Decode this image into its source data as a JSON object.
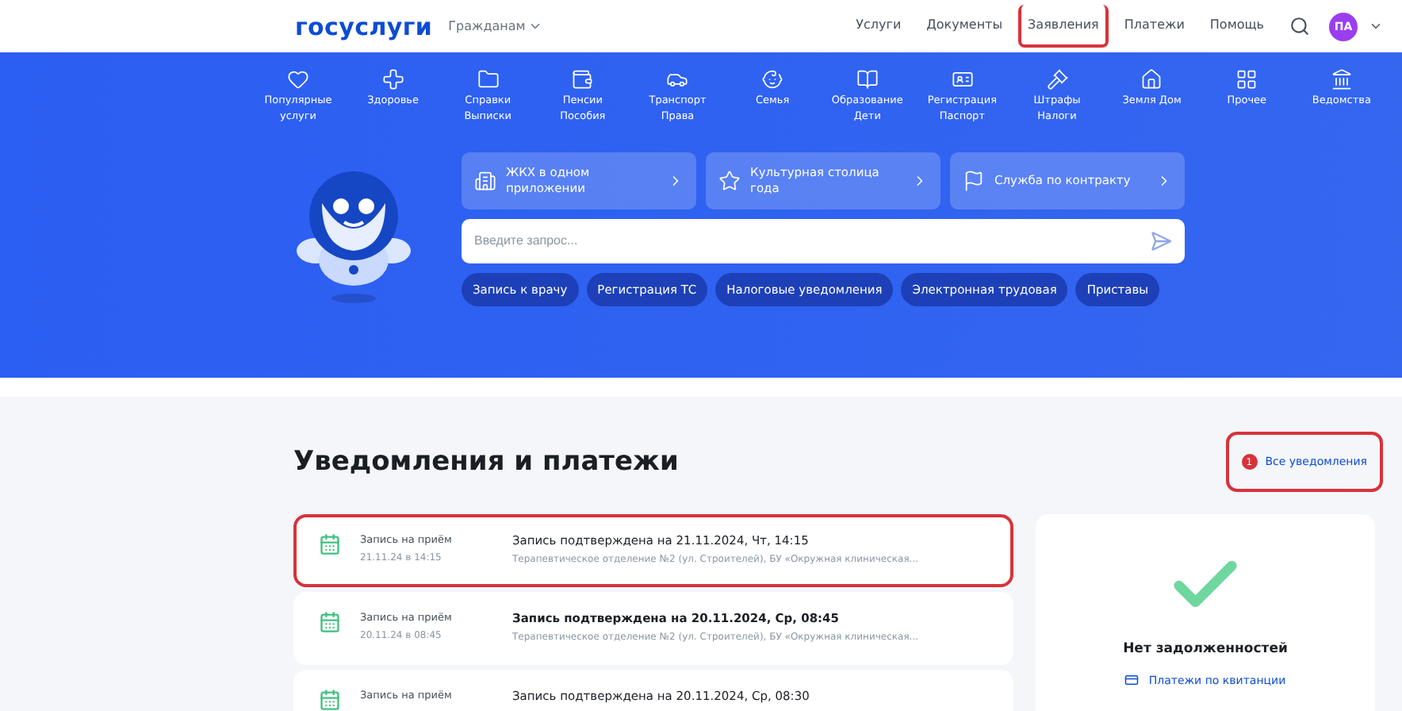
{
  "header": {
    "logo": "госуслуги",
    "audience": "Гражданам",
    "nav": [
      {
        "label": "Услуги",
        "highlighted": false
      },
      {
        "label": "Документы",
        "highlighted": false
      },
      {
        "label": "Заявления",
        "highlighted": true
      },
      {
        "label": "Платежи",
        "highlighted": false
      },
      {
        "label": "Помощь",
        "highlighted": false
      }
    ],
    "avatar": "ПА"
  },
  "categories": [
    {
      "lines": [
        "Популярные",
        "услуги"
      ]
    },
    {
      "lines": [
        "Здоровье"
      ]
    },
    {
      "lines": [
        "Справки",
        "Выписки"
      ]
    },
    {
      "lines": [
        "Пенсии",
        "Пособия"
      ]
    },
    {
      "lines": [
        "Транспорт",
        "Права"
      ]
    },
    {
      "lines": [
        "Семья"
      ]
    },
    {
      "lines": [
        "Образование",
        "Дети"
      ]
    },
    {
      "lines": [
        "Регистрация",
        "Паспорт"
      ]
    },
    {
      "lines": [
        "Штрафы",
        "Налоги"
      ]
    },
    {
      "lines": [
        "Земля Дом"
      ]
    },
    {
      "lines": [
        "Прочее"
      ]
    },
    {
      "lines": [
        "Ведомства"
      ]
    }
  ],
  "quick_links": [
    {
      "label": "ЖКХ в одном приложении"
    },
    {
      "label": "Культурная столица года"
    },
    {
      "label": "Служба по контракту"
    }
  ],
  "search": {
    "placeholder": "Введите запрос..."
  },
  "chips": [
    "Запись к врачу",
    "Регистрация ТС",
    "Налоговые уведомления",
    "Электронная трудовая",
    "Приставы"
  ],
  "notifications": {
    "title": "Уведомления и платежи",
    "all_link": {
      "label": "Все уведомления",
      "badge": "1",
      "highlighted": true
    },
    "items": [
      {
        "type": "Запись на приём",
        "date": "21.11.24 в 14:15",
        "title": "Запись подтверждена на 21.11.2024, Чт, 14:15",
        "detail": "Терапевтическое отделение №2 (ул. Строителей), БУ «Окружная клиническая...",
        "highlighted": true,
        "unread": false
      },
      {
        "type": "Запись на приём",
        "date": "20.11.24 в 08:45",
        "title": "Запись подтверждена на 20.11.2024, Ср, 08:45",
        "detail": "Терапевтическое отделение №2 (ул. Строителей), БУ «Окружная клиническая...",
        "highlighted": false,
        "unread": true
      },
      {
        "type": "Запись на приём",
        "title": "Запись подтверждена на 20.11.2024, Ср, 08:30",
        "highlighted": false,
        "unread": false
      }
    ]
  },
  "debt": {
    "title": "Нет задолженностей",
    "link": "Платежи по квитанции"
  }
}
